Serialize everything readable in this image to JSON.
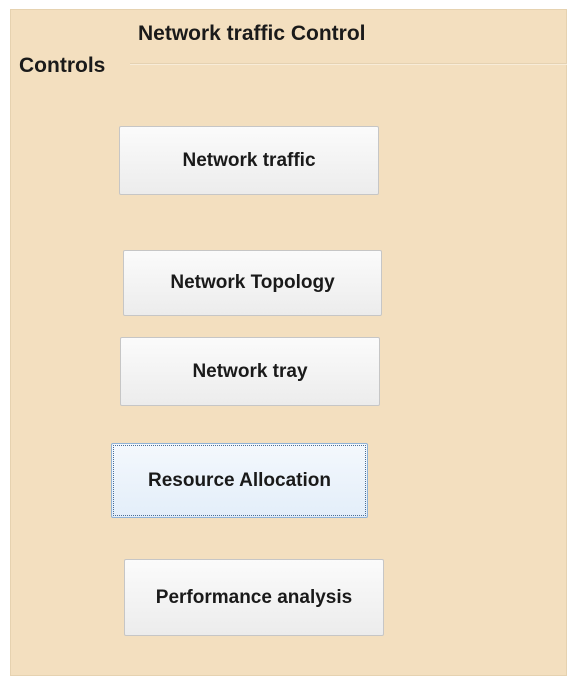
{
  "window": {
    "title": "Network traffic Control"
  },
  "group": {
    "label": "Controls"
  },
  "buttons": {
    "network_traffic": "Network traffic",
    "network_topology": "Network Topology",
    "network_tray": "Network tray",
    "resource_allocation": "Resource Allocation",
    "performance_analysis": "Performance analysis"
  },
  "colors": {
    "panel_background": "#f3dfbf",
    "button_background": "#efefef",
    "focused_button_border": "#8fb2d6"
  },
  "state": {
    "focused_button": "Resource Allocation"
  }
}
